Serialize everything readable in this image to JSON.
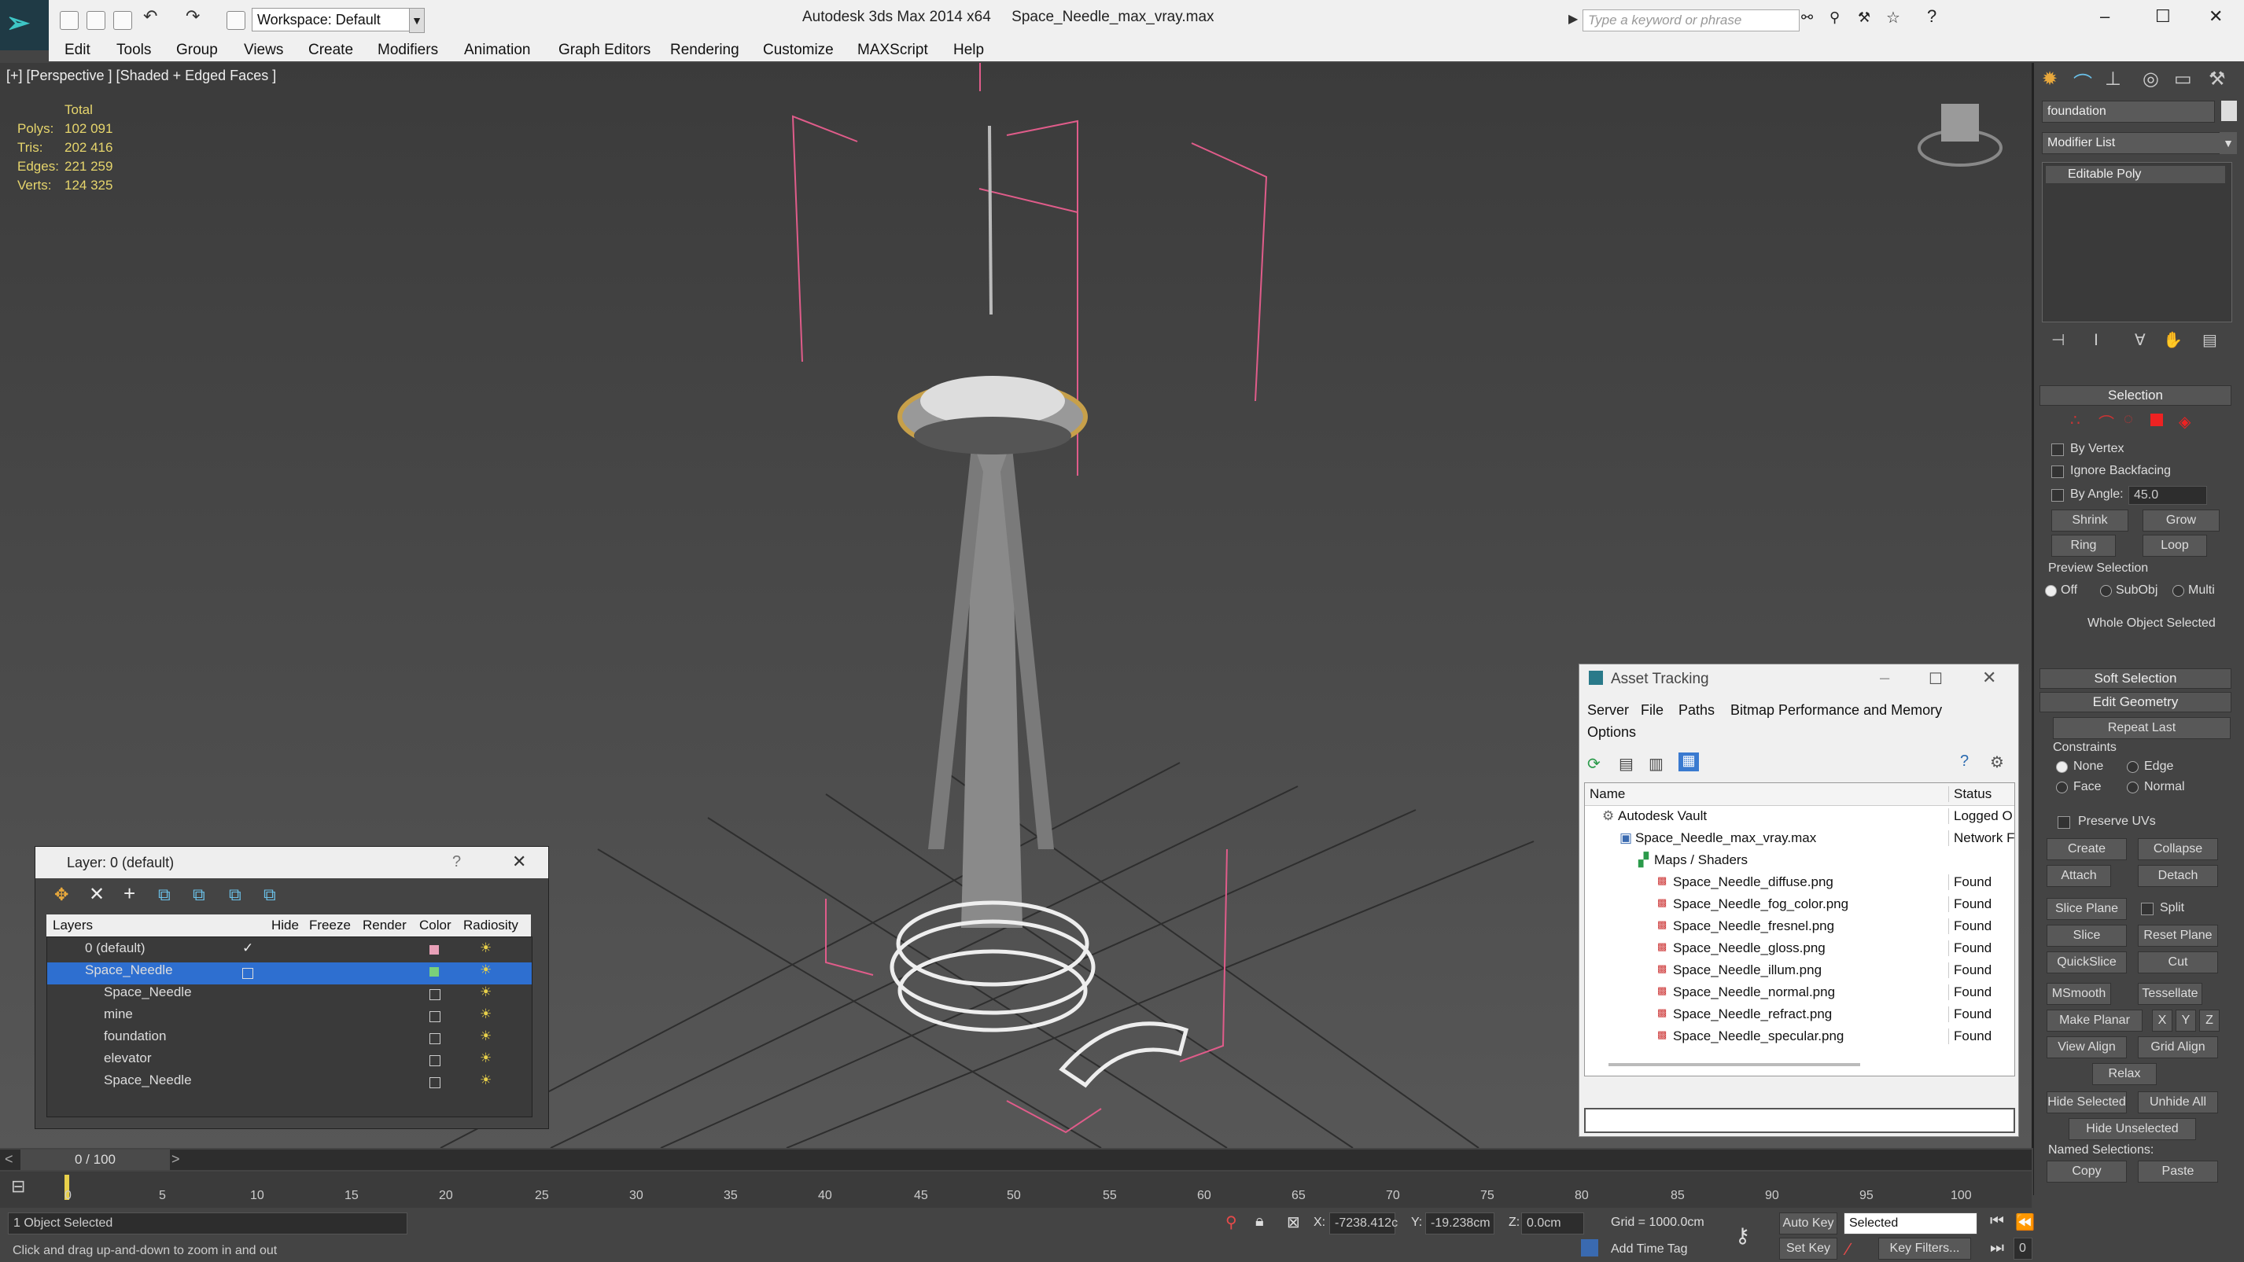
{
  "app": {
    "title": "Autodesk 3ds Max  2014 x64",
    "file": "Space_Needle_max_vray.max",
    "workspace": "Workspace: Default",
    "search_placeholder": "Type a keyword or phrase"
  },
  "menu": [
    "Edit",
    "Tools",
    "Group",
    "Views",
    "Create",
    "Modifiers",
    "Animation",
    "Graph Editors",
    "Rendering",
    "Customize",
    "MAXScript",
    "Help"
  ],
  "viewport": {
    "label": "[+] [Perspective ] [Shaded + Edged Faces ]",
    "stats": {
      "total": "Total",
      "rows": [
        {
          "k": "Polys:",
          "v": "102 091"
        },
        {
          "k": "Tris:",
          "v": "202 416"
        },
        {
          "k": "Edges:",
          "v": "221 259"
        },
        {
          "k": "Verts:",
          "v": "124 325"
        }
      ]
    }
  },
  "cmd": {
    "object_name": "foundation",
    "modifier_list": "Modifier List",
    "stack_item": "Editable Poly",
    "selection": {
      "title": "Selection",
      "by_vertex": "By Vertex",
      "ignore_backfacing": "Ignore Backfacing",
      "by_angle": "By Angle:",
      "angle_value": "45.0",
      "shrink": "Shrink",
      "grow": "Grow",
      "ring": "Ring",
      "loop": "Loop",
      "preview": "Preview Selection",
      "off": "Off",
      "subobj": "SubObj",
      "multi": "Multi",
      "status": "Whole Object Selected"
    },
    "soft_selection": "Soft Selection",
    "edit_geometry": {
      "title": "Edit Geometry",
      "repeat_last": "Repeat Last",
      "constraints": "Constraints",
      "none": "None",
      "edge": "Edge",
      "face": "Face",
      "normal": "Normal",
      "preserve_uvs": "Preserve UVs",
      "create": "Create",
      "collapse": "Collapse",
      "attach": "Attach",
      "detach": "Detach",
      "slice_plane": "Slice Plane",
      "split": "Split",
      "slice": "Slice",
      "reset_plane": "Reset Plane",
      "quickslice": "QuickSlice",
      "cut": "Cut",
      "msmooth": "MSmooth",
      "tessellate": "Tessellate",
      "make_planar": "Make Planar",
      "x": "X",
      "y": "Y",
      "z": "Z",
      "view_align": "View Align",
      "grid_align": "Grid Align",
      "relax": "Relax",
      "hide_selected": "Hide Selected",
      "unhide_all": "Unhide All",
      "hide_unselected": "Hide Unselected",
      "named_selections": "Named Selections:",
      "copy": "Copy",
      "paste": "Paste"
    }
  },
  "layer_dialog": {
    "title": "Layer: 0 (default)",
    "columns": [
      "Layers",
      "Hide",
      "Freeze",
      "Render",
      "Color",
      "Radiosity"
    ],
    "rows": [
      {
        "name": "0 (default)",
        "color": "#e8a0b8"
      },
      {
        "name": "Space_Needle",
        "color": "#7ad07a"
      },
      {
        "name": "Space_Needle",
        "color": ""
      },
      {
        "name": "mine",
        "color": ""
      },
      {
        "name": "foundation",
        "color": ""
      },
      {
        "name": "elevator",
        "color": ""
      },
      {
        "name": "Space_Needle",
        "color": ""
      }
    ]
  },
  "asset_dialog": {
    "title": "Asset Tracking",
    "menu": [
      "Server",
      "File",
      "Paths",
      "Bitmap Performance and Memory",
      "Options"
    ],
    "columns": [
      "Name",
      "Status"
    ],
    "rows": [
      {
        "name": "Autodesk Vault",
        "status": "Logged O"
      },
      {
        "name": "Space_Needle_max_vray.max",
        "status": "Network F"
      },
      {
        "name": "Maps / Shaders",
        "status": ""
      },
      {
        "name": "Space_Needle_diffuse.png",
        "status": "Found"
      },
      {
        "name": "Space_Needle_fog_color.png",
        "status": "Found"
      },
      {
        "name": "Space_Needle_fresnel.png",
        "status": "Found"
      },
      {
        "name": "Space_Needle_gloss.png",
        "status": "Found"
      },
      {
        "name": "Space_Needle_illum.png",
        "status": "Found"
      },
      {
        "name": "Space_Needle_normal.png",
        "status": "Found"
      },
      {
        "name": "Space_Needle_refract.png",
        "status": "Found"
      },
      {
        "name": "Space_Needle_specular.png",
        "status": "Found"
      }
    ]
  },
  "timeline": {
    "frame": "0 / 100",
    "ticks": [
      "0",
      "5",
      "10",
      "15",
      "20",
      "25",
      "30",
      "35",
      "40",
      "45",
      "50",
      "55",
      "60",
      "65",
      "70",
      "75",
      "80",
      "85",
      "90",
      "95",
      "100"
    ]
  },
  "status": {
    "selected": "1 Object Selected",
    "hint": "Click and drag up-and-down to zoom in and out",
    "x_label": "X:",
    "x": "-7238.412c",
    "y_label": "Y:",
    "y": "-19.238cm",
    "z_label": "Z:",
    "z": "0.0cm",
    "grid": "Grid = 1000.0cm",
    "auto_key": "Auto Key",
    "set_key": "Set Key",
    "selected_dd": "Selected",
    "key_filters": "Key Filters...",
    "add_time_tag": "Add Time Tag",
    "frame_field": "0"
  }
}
